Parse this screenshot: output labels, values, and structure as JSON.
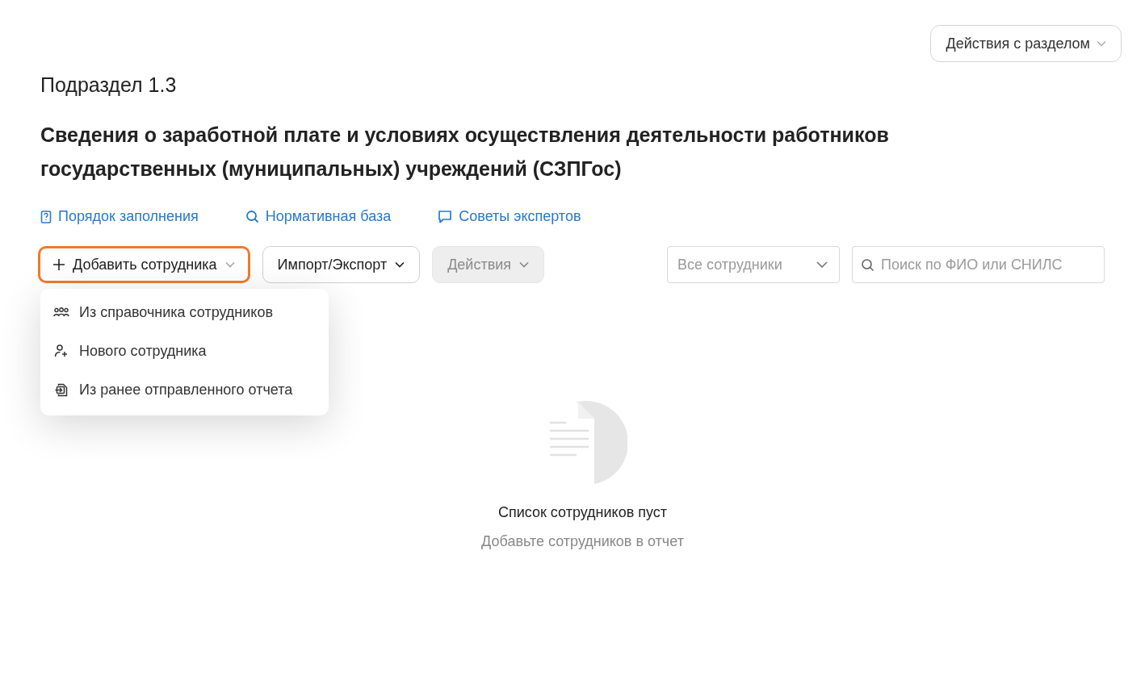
{
  "section_actions": {
    "label": "Действия с разделом"
  },
  "subtitle": "Подраздел 1.3",
  "title": "Сведения о заработной плате и условиях осуществления деятельности работников государственных (муниципальных) учреждений (СЗПГос)",
  "links": [
    {
      "kind": "book",
      "label": "Порядок заполнения"
    },
    {
      "kind": "search",
      "label": "Нормативная база"
    },
    {
      "kind": "chat",
      "label": "Советы экспертов"
    }
  ],
  "toolbar": {
    "buttons": [
      {
        "kind": "add",
        "label": "Добавить сотрудника",
        "open": true,
        "disabled": false
      },
      {
        "kind": "plain",
        "label": "Импорт/Экспорт",
        "open": false,
        "disabled": false
      },
      {
        "kind": "plain",
        "label": "Действия",
        "open": false,
        "disabled": true
      }
    ],
    "filter": {
      "placeholder": "Все сотрудники"
    },
    "search": {
      "placeholder": "Поиск по ФИО или СНИЛС"
    }
  },
  "add_menu": [
    {
      "kind": "group",
      "label": "Из справочника сотрудников"
    },
    {
      "kind": "person-add",
      "label": "Нового сотрудника"
    },
    {
      "kind": "doc-import",
      "label": "Из ранее отправленного отчета"
    }
  ],
  "empty_state": {
    "title": "Список сотрудников пуст",
    "hint": "Добавьте сотрудников в отчет"
  }
}
